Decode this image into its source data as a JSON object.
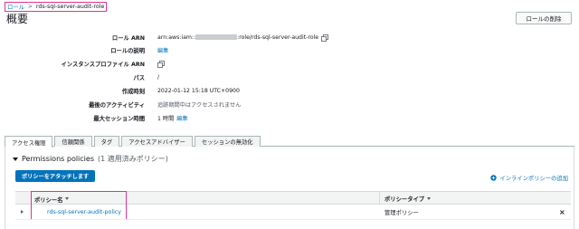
{
  "breadcrumb": {
    "root": "ロール",
    "separator": ">",
    "current": "rds-sql-server-audit-role"
  },
  "page_title": "概要",
  "delete_button": "ロールの削除",
  "summary": {
    "role_arn_label": "ロール ARN",
    "role_arn_prefix": "arn:aws:iam::",
    "role_arn_suffix": ":role/rds-sql-server-audit-role",
    "description_label": "ロールの説明",
    "description_value": "編集",
    "instance_profile_label": "インスタンスプロファイル ARN",
    "path_label": "パス",
    "path_value": "/",
    "created_label": "作成時刻",
    "created_value": "2022-01-12 15:18 UTC+0900",
    "last_activity_label": "最後のアクティビティ",
    "last_activity_value": "追跡期間中はアクセスされません",
    "max_session_label": "最大セッション時間",
    "max_session_value": "1 時間",
    "max_session_edit": "編集"
  },
  "tabs": [
    {
      "label": "アクセス権限"
    },
    {
      "label": "信頼関係"
    },
    {
      "label": "タグ"
    },
    {
      "label": "アクセスアドバイザー"
    },
    {
      "label": "セッションの無効化"
    }
  ],
  "policies": {
    "title": "Permissions policies",
    "count": "(1 適用済みポリシー)",
    "attach_button": "ポリシーをアタッチします",
    "inline_button": "インラインポリシーの追加",
    "columns": {
      "name": "ポリシー名",
      "type": "ポリシータイプ"
    },
    "rows": [
      {
        "name": "rds-sql-server-audit-policy",
        "type": "管理ポリシー"
      }
    ]
  },
  "colors": {
    "link": "#0073bb",
    "highlight": "#e0338f",
    "primary_button": "#0073bb"
  }
}
